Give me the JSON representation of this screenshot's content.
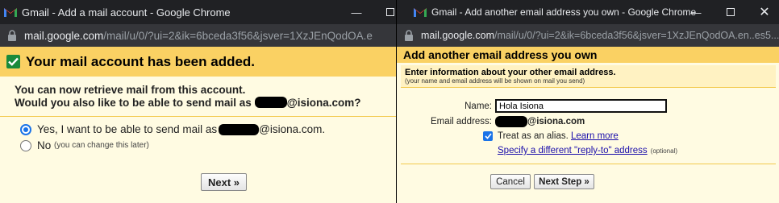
{
  "left_window": {
    "title": "Gmail - Add a mail account - Google Chrome",
    "url_host": "mail.google.com",
    "url_path": "/mail/u/0/?ui=2&ik=6bceda3f56&jsver=1XzJEnQodOA.e",
    "header_title": "Your mail account has been added.",
    "message_line1": "You can now retrieve mail from this account.",
    "message_line2_prefix": "Would you also like to be able to send mail as",
    "email_domain": "@isiona.com?",
    "options": {
      "yes_label": "Yes, I want to be able to send mail as",
      "yes_domain": "@isiona.com.",
      "yes_selected": true,
      "no_label": "No",
      "no_note": "(you can change this later)"
    },
    "next_button": "Next »"
  },
  "right_window": {
    "title": "Gmail - Add another email address you own - Google Chrome",
    "url_host": "mail.google.com",
    "url_path": "/mail/u/0/?ui=2&ik=6bceda3f56&jsver=1XzJEnQodOA.en..es5...",
    "header_title": "Add another email address you own",
    "info_title": "Enter information about your other email address.",
    "info_subtitle": "(your name and email address will be shown on mail you send)",
    "name_label": "Name:",
    "name_value": "Hola Isiona",
    "email_label": "Email address:",
    "email_domain": "@isiona.com",
    "alias_label": "Treat as an alias.",
    "alias_checked": true,
    "learn_more": "Learn more",
    "reply_to_link": "Specify a different \"reply-to\" address",
    "reply_to_optional": "(optional)",
    "cancel_button": "Cancel",
    "next_step_button": "Next Step »"
  },
  "colors": {
    "header_yellow": "#fad163",
    "content_bg": "#fffbe2",
    "titlebar": "#202124",
    "addressbar": "#35363a",
    "accent_blue": "#1a73e8",
    "link": "#1a0dab",
    "check_green": "#1a8a3c"
  },
  "icons": [
    "gmail-icon",
    "lock-icon",
    "checkmark-icon",
    "minimize-icon",
    "maximize-icon",
    "close-icon"
  ]
}
